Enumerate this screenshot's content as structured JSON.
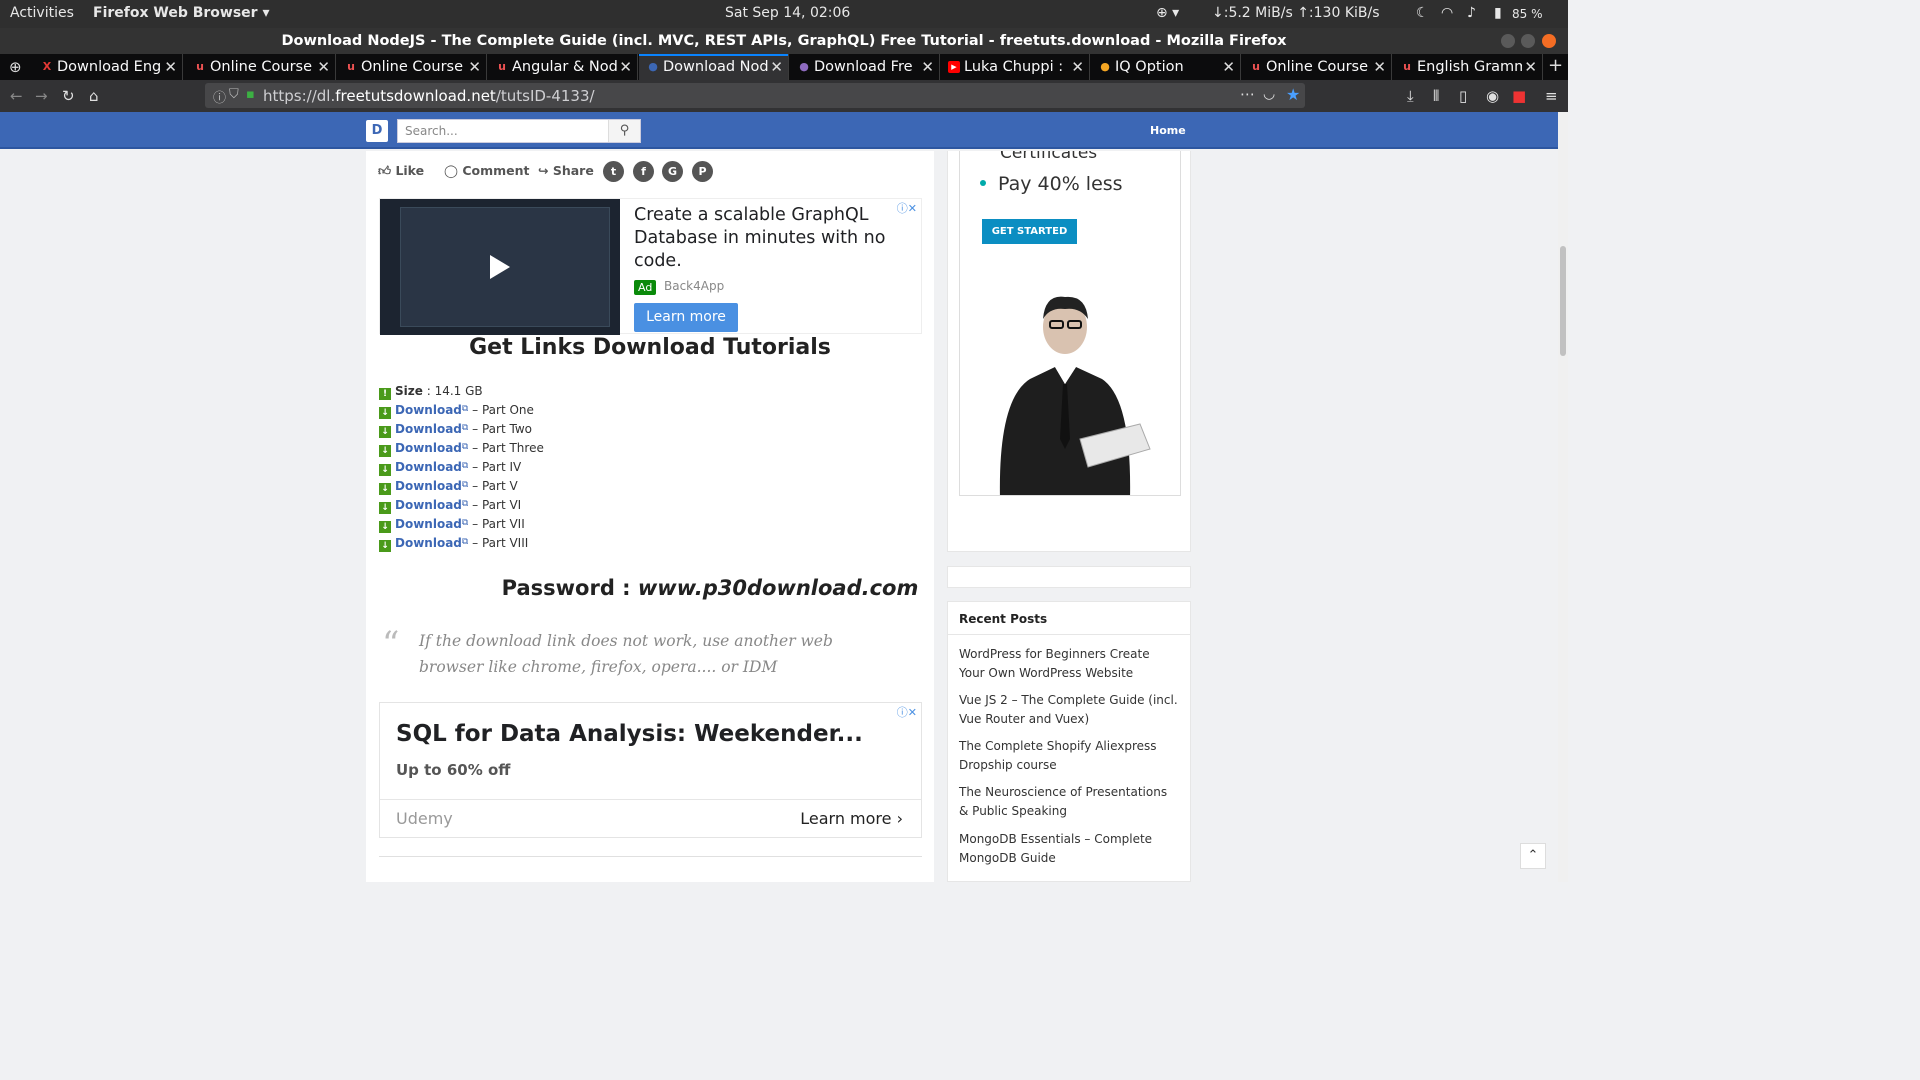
{
  "system_bar": {
    "activities": "Activities",
    "app_menu": "Firefox Web Browser ▾",
    "clock": "Sat Sep 14, 02:06",
    "network_speed": "↓:5.2 MiB/s ↑:130 KiB/s",
    "battery": "85 %"
  },
  "window": {
    "title": "Download NodeJS - The Complete Guide (incl. MVC, REST APIs, GraphQL) Free Tutorial - freetuts.download - Mozilla Firefox"
  },
  "tabs": [
    {
      "label": "Download Eng",
      "icon": "x-icon",
      "color": "#e53935"
    },
    {
      "label": "Online Course",
      "icon": "udemy-icon",
      "color": "#ec5252"
    },
    {
      "label": "Online Course",
      "icon": "udemy-icon",
      "color": "#ec5252"
    },
    {
      "label": "Angular & Nod",
      "icon": "udemy-icon",
      "color": "#ec5252"
    },
    {
      "label": "Download Nod",
      "icon": "site-icon",
      "color": "#3c67b5",
      "active": true
    },
    {
      "label": "Download Fre",
      "icon": "globe-icon",
      "color": "#8e6bbf"
    },
    {
      "label": "Luka Chuppi : ",
      "icon": "youtube-icon",
      "color": "#ff0000"
    },
    {
      "label": "IQ Option",
      "icon": "iq-option-icon",
      "color": "#f5a623"
    },
    {
      "label": "Online Course",
      "icon": "udemy-icon",
      "color": "#ec5252"
    },
    {
      "label": "English Gramm",
      "icon": "udemy-icon",
      "color": "#ec5252"
    }
  ],
  "nav": {
    "url_prefix": "https://dl.",
    "url_domain": "freetutsdownload.net",
    "url_path": "/tutsID-4133/"
  },
  "site": {
    "logo": "D",
    "search_placeholder": "Search...",
    "home_link": "Home"
  },
  "social": {
    "like": "Like",
    "comment": "Comment",
    "share": "Share",
    "icons": [
      "twitter-icon",
      "facebook-icon",
      "google-plus-icon",
      "pinterest-icon"
    ]
  },
  "ad1": {
    "headline": "Create a scalable GraphQL Database in minutes with no code.",
    "badge": "Ad",
    "source": "Back4App",
    "button": "Learn more"
  },
  "downloads": {
    "title": "Get Links Download Tutorials",
    "size_label": "Size",
    "size_value": ": 14.1 GB",
    "link_text": "Download",
    "parts": [
      "– Part One",
      "– Part Two",
      "– Part Three",
      "– Part IV",
      "– Part V",
      "– Part VI",
      "– Part VII",
      "– Part VIII"
    ]
  },
  "password": {
    "label": "Password :",
    "value": "www.p30download.com"
  },
  "quote": "If the download link does not work, use another web browser like chrome, firefox, opera.... or IDM",
  "ad2": {
    "headline": "SQL for Data Analysis: Weekender...",
    "subline": "Up to 60% off",
    "source": "Udemy",
    "button": "Learn more"
  },
  "sidebar_ad": {
    "cert_text": "Certificates",
    "bullet": "Pay 40% less",
    "button": "GET STARTED"
  },
  "recent_posts": {
    "title": "Recent Posts",
    "items": [
      "WordPress for Beginners Create Your Own WordPress Website",
      "Vue JS 2 – The Complete Guide (incl. Vue Router and Vuex)",
      "The Complete Shopify Aliexpress Dropship course",
      "The Neuroscience of Presentations & Public Speaking",
      "MongoDB Essentials – Complete MongoDB Guide"
    ]
  }
}
